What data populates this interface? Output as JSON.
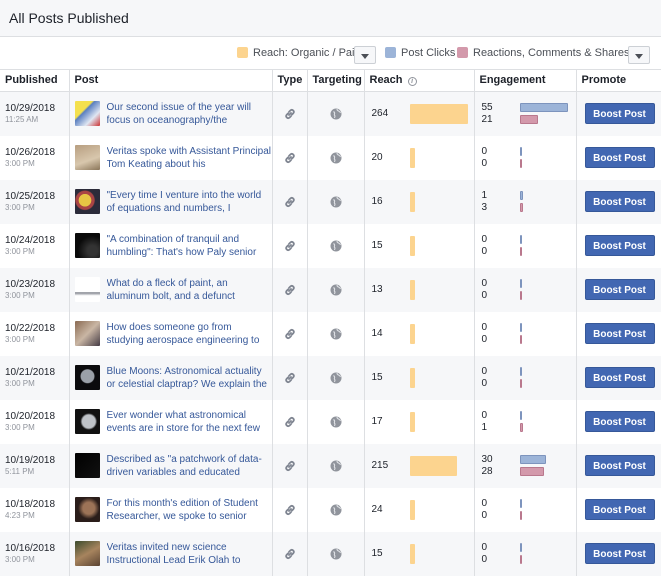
{
  "page_title": "All Posts Published",
  "legend": {
    "reach": "Reach: Organic / Paid",
    "clicks": "Post Clicks",
    "reactions": "Reactions, Comments & Shares",
    "colors": {
      "reach": "#fcd48f",
      "clicks": "#9cb4d8",
      "reactions": "#d399ab"
    }
  },
  "columns": [
    "Published",
    "Post",
    "Type",
    "Targeting",
    "Reach",
    "Engagement",
    "Promote"
  ],
  "info_glyph": "i",
  "rows": [
    {
      "date": "10/29/2018",
      "time": "11:25 AM",
      "text": "Our second issue of the year will focus on oceanography/the",
      "reach": 264,
      "clicks": 55,
      "reactions": 21,
      "button": "Boost Post"
    },
    {
      "date": "10/26/2018",
      "time": "3:00 PM",
      "text": "Veritas spoke with Assistant Principal Tom Keating about his",
      "reach": 20,
      "clicks": 0,
      "reactions": 0,
      "button": "Boost Post"
    },
    {
      "date": "10/25/2018",
      "time": "3:00 PM",
      "text": "\"Every time I venture into the world of equations and numbers, I",
      "reach": 16,
      "clicks": 1,
      "reactions": 3,
      "button": "Boost Post"
    },
    {
      "date": "10/24/2018",
      "time": "3:00 PM",
      "text": "\"A combination of tranquil and humbling\": That's how Paly senior",
      "reach": 15,
      "clicks": 0,
      "reactions": 0,
      "button": "Boost Post"
    },
    {
      "date": "10/23/2018",
      "time": "3:00 PM",
      "text": "What do a fleck of paint, an aluminum bolt, and a defunct",
      "reach": 13,
      "clicks": 0,
      "reactions": 0,
      "button": "Boost Post"
    },
    {
      "date": "10/22/2018",
      "time": "3:00 PM",
      "text": "How does someone go from studying aerospace engineering to",
      "reach": 14,
      "clicks": 0,
      "reactions": 0,
      "button": "Boost Post"
    },
    {
      "date": "10/21/2018",
      "time": "3:00 PM",
      "text": "Blue Moons: Astronomical actuality or celestial claptrap? We explain the",
      "reach": 15,
      "clicks": 0,
      "reactions": 0,
      "button": "Boost Post"
    },
    {
      "date": "10/20/2018",
      "time": "3:00 PM",
      "text": "Ever wonder what astronomical events are in store for the next few",
      "reach": 17,
      "clicks": 0,
      "reactions": 1,
      "button": "Boost Post"
    },
    {
      "date": "10/19/2018",
      "time": "5:11 PM",
      "text": "Described as \"a patchwork of data-driven variables and educated",
      "reach": 215,
      "clicks": 30,
      "reactions": 28,
      "button": "Boost Post"
    },
    {
      "date": "10/18/2018",
      "time": "4:23 PM",
      "text": "For this month's edition of Student Researcher, we spoke to senior",
      "reach": 24,
      "clicks": 0,
      "reactions": 0,
      "button": "Boost Post"
    },
    {
      "date": "10/16/2018",
      "time": "3:00 PM",
      "text": "Veritas invited new science Instructional Lead Erik Olah to",
      "reach": 15,
      "clicks": 0,
      "reactions": 0,
      "button": "Boost Post"
    }
  ]
}
